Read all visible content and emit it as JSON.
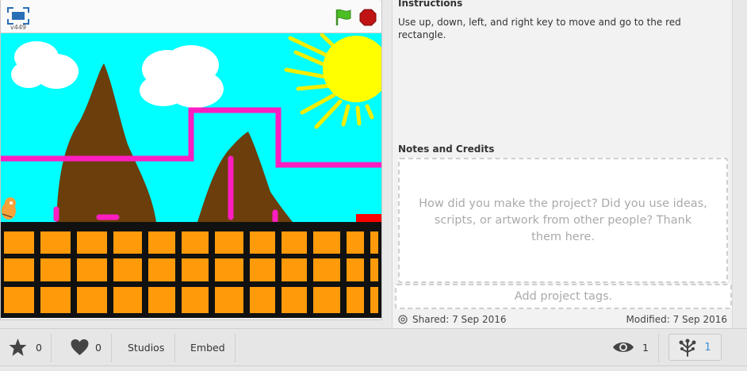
{
  "player": {
    "version": "v449",
    "fullscreen_icon": "fullscreen-icon",
    "green_flag_icon": "green-flag-icon",
    "stop_icon": "stop-sign-icon",
    "colors": {
      "sky": "#00ffff",
      "mountain": "#6b3e0c",
      "path": "#ff1dc1",
      "ground": "#ff9a0a",
      "goal": "#ff0000",
      "sun": "#ffff00"
    }
  },
  "side": {
    "instructions_heading": "Instructions",
    "instructions_text": "Use up, down, left, and right key to move and go to the red rectangle.",
    "notes_heading": "Notes and Credits",
    "notes_placeholder": "How did you make the project? Did you use ideas, scripts, or artwork from other people? Thank them here.",
    "tags_placeholder": "Add project tags.",
    "shared": "Shared: 7 Sep 2016",
    "modified": "Modified: 7 Sep 2016"
  },
  "bottom_bar": {
    "favorites_count": "0",
    "loves_count": "0",
    "studios_label": "Studios",
    "embed_label": "Embed",
    "views_count": "1",
    "remix_count": "1"
  }
}
